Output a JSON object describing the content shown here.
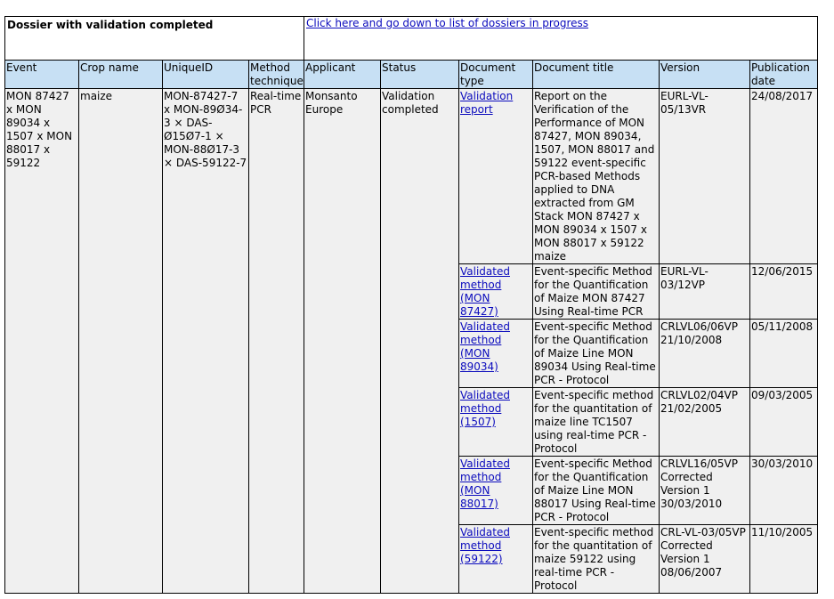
{
  "top": {
    "title": "Dossier with validation completed",
    "link": "Click here and go down to list of dossiers in progress"
  },
  "headers": {
    "event": "Event",
    "crop": "Crop name",
    "uniqueid": "UniqueID",
    "method": "Method technique",
    "applicant": "Applicant",
    "status": "Status",
    "doctype": "Document type",
    "doctitle": "Document title",
    "version": "Version",
    "pubdate": "Publication date"
  },
  "record": {
    "event": "MON 87427 x MON 89034 x 1507 x MON 88017 x 59122",
    "crop": "maize",
    "uniqueid": "MON-87427-7 x MON-89Ø34-3 × DAS-Ø15Ø7-1 × MON-88Ø17-3 × DAS-59122-7",
    "method": "Real-time PCR",
    "applicant": "Monsanto Europe",
    "status": "Validation completed"
  },
  "documents": [
    {
      "type": "Validation report",
      "title": "Report on the Verification of the Performance of MON 87427, MON 89034, 1507, MON 88017 and 59122 event-specific PCR-based Methods applied to DNA extracted from GM Stack MON 87427 x MON 89034 x 1507 x MON 88017 x 59122 maize",
      "version": "EURL-VL-05/13VR",
      "date": "24/08/2017"
    },
    {
      "type": "Validated method (MON 87427)",
      "title": "Event-specific Method for the Quantification of Maize MON 87427 Using Real-time PCR",
      "version": "EURL-VL-03/12VP",
      "date": "12/06/2015"
    },
    {
      "type": "Validated method (MON 89034)",
      "title": "Event-specific Method for the Quantification of Maize Line MON 89034 Using Real-time PCR - Protocol",
      "version": "CRLVL06/06VP 21/10/2008",
      "date": "05/11/2008"
    },
    {
      "type": "Validated method (1507)",
      "title": "Event-specific method for the quantitation of maize line TC1507 using real-time PCR - Protocol",
      "version": "CRLVL02/04VP 21/02/2005",
      "date": "09/03/2005"
    },
    {
      "type": "Validated method (MON 88017)",
      "title": "Event-specific Method for the Quantification of Maize Line MON 88017 Using Real-time PCR - Protocol",
      "version": "CRLVL16/05VP Corrected Version 1 30/03/2010",
      "date": "30/03/2010"
    },
    {
      "type": "Validated method (59122)",
      "title": "Event-specific method for the quantitation of maize 59122 using real-time PCR - Protocol",
      "version": "CRL-VL-03/05VP Corrected Version 1 08/06/2007",
      "date": "11/10/2005"
    }
  ]
}
